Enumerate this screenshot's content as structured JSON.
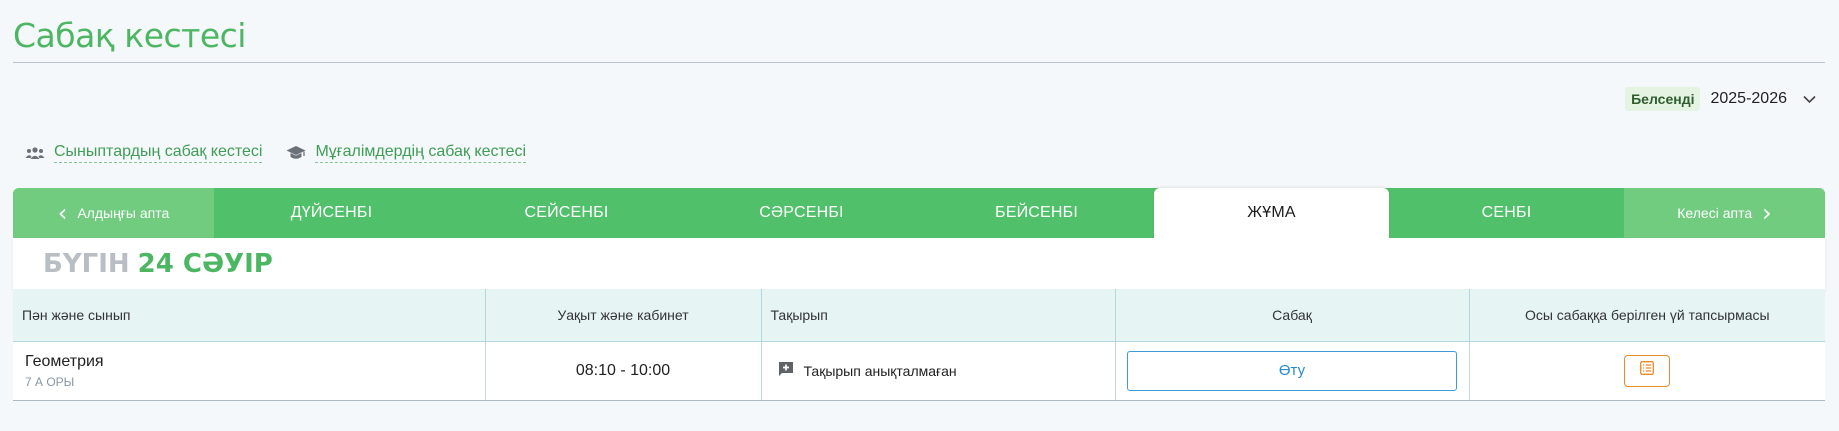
{
  "page": {
    "title": "Сабақ кестесі"
  },
  "year_selector": {
    "badge": "Белсенді",
    "year": "2025-2026"
  },
  "links": [
    {
      "label": "Сыныптардың сабақ кестесі",
      "icon": "people-icon"
    },
    {
      "label": "Мұғалімдердің сабақ кестесі",
      "icon": "graduation-cap-icon"
    }
  ],
  "days_nav": {
    "prev": "Алдыңғы апта",
    "next": "Келесі апта",
    "days": [
      "ДҮЙСЕНБІ",
      "СЕЙСЕНБІ",
      "СӘРСЕНБІ",
      "БЕЙСЕНБІ",
      "ЖҰМА",
      "СЕНБІ"
    ],
    "active_index": 4
  },
  "today": {
    "label": "БҮГІН",
    "date": "24 СӘУІР"
  },
  "table": {
    "headers": {
      "subject": "Пән және сынып",
      "time": "Уақыт және кабинет",
      "topic": "Тақырып",
      "lesson": "Сабақ",
      "homework": "Осы сабаққа берілген үй тапсырмасы"
    },
    "rows": [
      {
        "subject": "Геометрия",
        "class": "7 А ОРЫ",
        "time": "08:10 - 10:00",
        "topic": "Тақырып анықталмаған",
        "lesson_button": "Өту"
      }
    ]
  },
  "colors": {
    "accent_green": "#4cb663",
    "nav_green": "#50c16a",
    "nav_light": "#72cc80",
    "link_blue": "#2a89cf",
    "homework_orange": "#ec8b2b"
  }
}
